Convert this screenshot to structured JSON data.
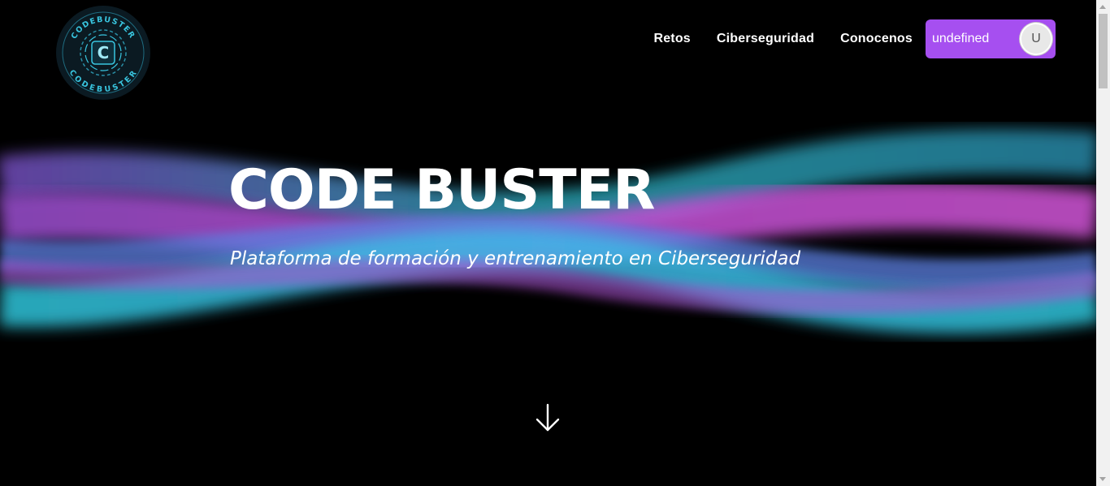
{
  "logo": {
    "ring_text_top": "CODEBUSTER",
    "ring_text_bottom": "CODEBUSTER",
    "monogram": "C",
    "accent": "#39c6e0"
  },
  "nav": {
    "links": [
      "Retos",
      "Ciberseguridad",
      "Conocenos"
    ],
    "user": {
      "name": "undefined",
      "avatar_initial": "U",
      "pill_color": "#a64ff0"
    }
  },
  "hero": {
    "title": "CODE BUSTER",
    "subtitle": "Plataforma de formación y entrenamiento en Ciberseguridad",
    "scroll_icon": "arrow-down-icon"
  },
  "colors": {
    "background": "#000000",
    "wave_cyan": "#2ec4d9",
    "wave_magenta": "#c04fd6",
    "wave_blue": "#5b7fe0"
  }
}
